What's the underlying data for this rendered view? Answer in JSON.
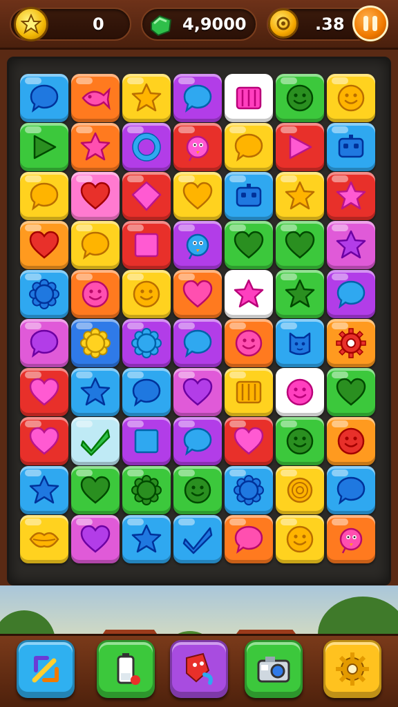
{
  "hud": {
    "stars_value": "0",
    "gems_value": "4,9000",
    "coins_value": ".38"
  },
  "board": {
    "rows": [
      [
        [
          "#2fa8f0",
          "bubble-icon"
        ],
        [
          "#ff7a1f",
          "fish-icon"
        ],
        [
          "#ffd21f",
          "star-icon"
        ],
        [
          "#b23de8",
          "bubble-icon"
        ],
        [
          "#ffffff",
          "crate-icon"
        ],
        [
          "#3cc83c",
          "face-icon"
        ],
        [
          "#ffd21f",
          "face-icon"
        ]
      ],
      [
        [
          "#3cc83c",
          "triangle-icon"
        ],
        [
          "#ff7a1f",
          "star-icon"
        ],
        [
          "#b23de8",
          "ring-icon"
        ],
        [
          "#e8302a",
          "bird-icon"
        ],
        [
          "#ffd21f",
          "bubble-icon"
        ],
        [
          "#e8302a",
          "triangle-icon"
        ],
        [
          "#2fa8f0",
          "robot-icon"
        ]
      ],
      [
        [
          "#ffd21f",
          "bubble-icon"
        ],
        [
          "#ff7ad0",
          "heart-icon"
        ],
        [
          "#e8302a",
          "diamond-icon"
        ],
        [
          "#ffd21f",
          "heart-icon"
        ],
        [
          "#2fa8f0",
          "robot-icon"
        ],
        [
          "#ffd21f",
          "star-icon"
        ],
        [
          "#e8302a",
          "star-icon"
        ]
      ],
      [
        [
          "#ff9a1f",
          "heart-icon"
        ],
        [
          "#ffd21f",
          "bubble-icon"
        ],
        [
          "#e8302a",
          "square-icon"
        ],
        [
          "#b23de8",
          "bird-icon"
        ],
        [
          "#3cc83c",
          "heart-icon"
        ],
        [
          "#3cc83c",
          "heart-icon"
        ],
        [
          "#e05ad8",
          "star-icon"
        ]
      ],
      [
        [
          "#2fa8f0",
          "sun-icon"
        ],
        [
          "#ff7a1f",
          "face-icon"
        ],
        [
          "#ffd21f",
          "face-icon"
        ],
        [
          "#ff7a1f",
          "heart-icon"
        ],
        [
          "#ffffff",
          "star-icon"
        ],
        [
          "#3cc83c",
          "star-icon"
        ],
        [
          "#b23de8",
          "bubble-icon"
        ]
      ],
      [
        [
          "#e05ad8",
          "bubble-icon"
        ],
        [
          "#2f7ae8",
          "sun-icon"
        ],
        [
          "#b23de8",
          "sun-icon"
        ],
        [
          "#b23de8",
          "bubble-icon"
        ],
        [
          "#ff7a1f",
          "face-icon"
        ],
        [
          "#2fa8f0",
          "cat-icon"
        ],
        [
          "#ff9a1f",
          "gear-icon"
        ]
      ],
      [
        [
          "#e8302a",
          "heart-icon"
        ],
        [
          "#2fa8f0",
          "star-icon"
        ],
        [
          "#2fa8f0",
          "bubble-icon"
        ],
        [
          "#e05ad8",
          "heart-icon"
        ],
        [
          "#ffd21f",
          "crate-icon"
        ],
        [
          "#ffffff",
          "face-icon"
        ],
        [
          "#3cc83c",
          "heart-icon"
        ]
      ],
      [
        [
          "#e8302a",
          "heart-icon"
        ],
        [
          "#bfeaf5",
          "check-icon"
        ],
        [
          "#b23de8",
          "square-icon"
        ],
        [
          "#b23de8",
          "bubble-icon"
        ],
        [
          "#e8302a",
          "heart-icon"
        ],
        [
          "#3cc83c",
          "face-icon"
        ],
        [
          "#ff9a1f",
          "face-icon"
        ]
      ],
      [
        [
          "#2fa8f0",
          "star-icon"
        ],
        [
          "#3cc83c",
          "heart-icon"
        ],
        [
          "#3cc83c",
          "sun-icon"
        ],
        [
          "#3cc83c",
          "face-icon"
        ],
        [
          "#2fa8f0",
          "sun-icon"
        ],
        [
          "#ffd21f",
          "log-icon"
        ],
        [
          "#2fa8f0",
          "bubble-icon"
        ]
      ],
      [
        [
          "#ffd21f",
          "lips-icon"
        ],
        [
          "#e05ad8",
          "heart-icon"
        ],
        [
          "#2fa8f0",
          "star-icon"
        ],
        [
          "#2fa8f0",
          "check-icon"
        ],
        [
          "#ff7a1f",
          "bubble-icon"
        ],
        [
          "#ffd21f",
          "face-icon"
        ],
        [
          "#ff7a1f",
          "bird-icon"
        ]
      ]
    ]
  },
  "toolbar": {
    "buttons": [
      {
        "name": "swap-booster-button",
        "icon": "swap-arrows-icon",
        "color": "#2fb0f0"
      },
      {
        "name": "battery-booster-button",
        "icon": "battery-icon",
        "color": "#3cc83c"
      },
      {
        "name": "shield-booster-button",
        "icon": "shield-icon",
        "color": "#a84ce0"
      },
      {
        "name": "camera-button",
        "icon": "camera-icon",
        "color": "#3cc83c"
      },
      {
        "name": "settings-button",
        "icon": "gear-icon",
        "color": "#ffc21f"
      }
    ]
  }
}
